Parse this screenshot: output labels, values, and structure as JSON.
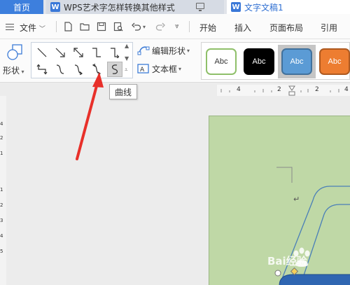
{
  "tabs": {
    "home": "首页",
    "doc1": "WPS艺术字怎样转换其他样式",
    "doc2": "文字文稿1",
    "logo_letter": "W"
  },
  "menu": {
    "file": "文件",
    "items": [
      "开始",
      "插入",
      "页面布局",
      "引用"
    ]
  },
  "ribbon": {
    "shape_label": "形状",
    "edit_shape": "编辑形状",
    "text_box": "文本框",
    "style_samples": [
      {
        "text": "Abc",
        "bg": "#ffffff",
        "fg": "#333333",
        "border": "#8fc06a"
      },
      {
        "text": "Abc",
        "bg": "#000000",
        "fg": "#ffffff",
        "border": "#000000"
      },
      {
        "text": "Abc",
        "bg": "#5b9bd5",
        "fg": "#ffffff",
        "border": "#41719c"
      },
      {
        "text": "Abc",
        "bg": "#ed7d31",
        "fg": "#ffffff",
        "border": "#ae5a21"
      }
    ]
  },
  "tooltip": {
    "text": "曲线"
  },
  "ruler": {
    "top_labels": [
      "4",
      "2",
      "2",
      "4"
    ],
    "left_labels": [
      "4",
      "2",
      "1",
      "1",
      "2",
      "3",
      "4",
      "5"
    ]
  },
  "document": {
    "paragraph_mark": "↵",
    "page_color": "#bfd8a6"
  },
  "watermark": {
    "text": "Bai经验"
  },
  "colors": {
    "accent": "#3d7fdd",
    "arrow": "#e8302a"
  }
}
